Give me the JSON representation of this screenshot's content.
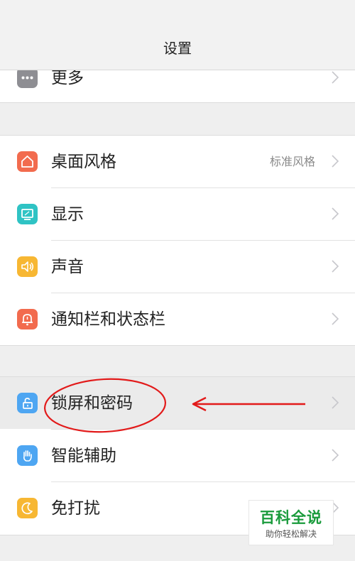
{
  "header": {
    "title": "设置"
  },
  "rows": {
    "more": {
      "label": "更多",
      "icon": "more-dots-icon"
    },
    "desktop": {
      "label": "桌面风格",
      "value": "标准风格",
      "icon": "home-icon",
      "color": "#f26b4e"
    },
    "display": {
      "label": "显示",
      "icon": "display-icon",
      "color": "#2fc3c4"
    },
    "sound": {
      "label": "声音",
      "icon": "speaker-icon",
      "color": "#f7b733"
    },
    "notification": {
      "label": "通知栏和状态栏",
      "icon": "bell-icon",
      "color": "#f26b4e"
    },
    "lock": {
      "label": "锁屏和密码",
      "icon": "lock-icon",
      "color": "#4ea6f2"
    },
    "assist": {
      "label": "智能辅助",
      "icon": "hand-icon",
      "color": "#4ea6f2"
    },
    "dnd": {
      "label": "免打扰",
      "icon": "moon-icon",
      "color": "#f7b733"
    }
  },
  "watermark": {
    "title": "百科全说",
    "subtitle": "助你轻松解决"
  },
  "annotation": {
    "color": "#e21a1a"
  }
}
